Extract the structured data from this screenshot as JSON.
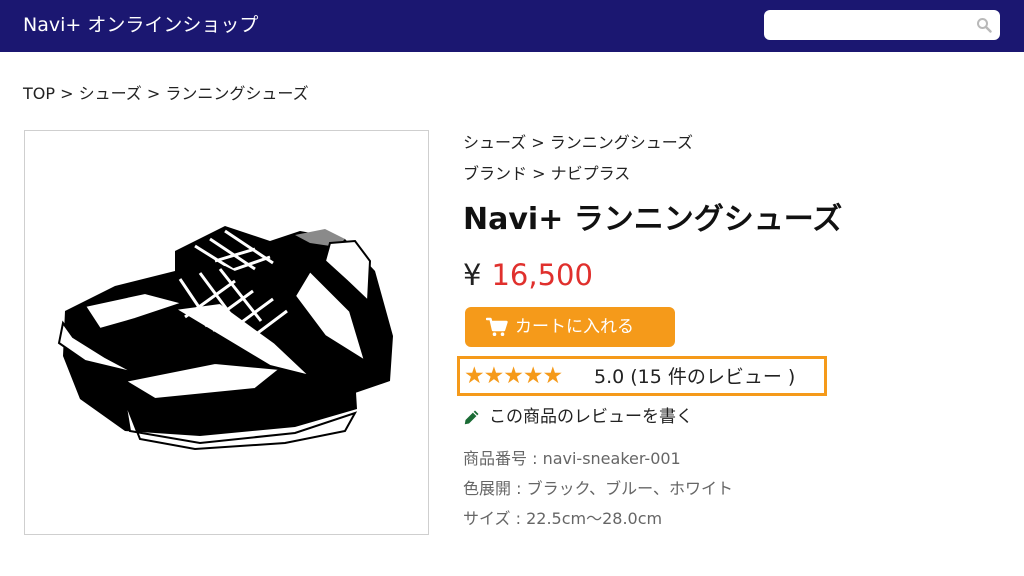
{
  "header": {
    "site_title": "Navi+ オンラインショップ",
    "search": {
      "value": "",
      "placeholder": ""
    },
    "colors": {
      "background": "#1b1771",
      "text": "#ffffff"
    }
  },
  "breadcrumb": "TOP > シューズ > ランニングシューズ",
  "product": {
    "category_path": "シューズ > ランニングシューズ",
    "brand_path": "ブランド > ナビプラス",
    "title": "Navi+ ランニングシューズ",
    "currency_symbol": "¥",
    "price": "16,500",
    "price_color": "#e0302d",
    "image_icon": "sneakers-illustration",
    "cart_button": {
      "label": "カートに入れる",
      "icon": "cart-icon",
      "color": "#f59a1a"
    },
    "rating": {
      "stars": "★★★★★",
      "star_count": 5,
      "text": "5.0 (15 件のレビュー )",
      "highlight_color": "#f59a1a"
    },
    "write_review": {
      "label": "この商品のレビューを書く",
      "icon": "pencil-icon"
    },
    "specs": [
      "商品番号 : navi-sneaker-001",
      "色展開 : ブラック、ブルー、ホワイト",
      "サイズ : 22.5cm〜28.0cm"
    ]
  }
}
